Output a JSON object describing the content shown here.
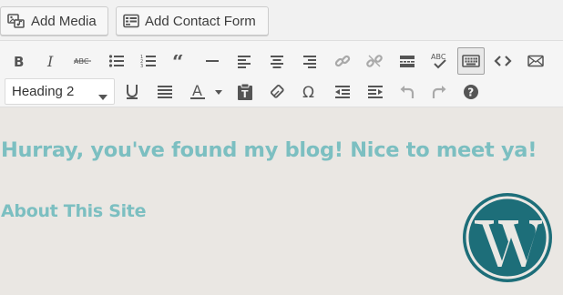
{
  "media_buttons": {
    "add_media": "Add Media",
    "add_contact_form": "Add Contact Form"
  },
  "toolbar": {
    "row1_icons": [
      "bold-icon",
      "italic-icon",
      "strikethrough-icon",
      "bullet-list-icon",
      "numbered-list-icon",
      "blockquote-icon",
      "horizontal-rule-icon",
      "align-left-icon",
      "align-center-icon",
      "align-right-icon",
      "insert-link-icon",
      "remove-link-icon",
      "read-more-icon",
      "spellcheck-icon",
      "toolbar-toggle-icon",
      "code-icon",
      "email-icon"
    ],
    "row2_icons": [
      "underline-icon",
      "justify-icon",
      "text-color-icon",
      "paste-as-text-icon",
      "clear-formatting-icon",
      "special-character-icon",
      "outdent-icon",
      "indent-icon",
      "undo-icon",
      "redo-icon",
      "help-icon"
    ],
    "format_select": {
      "selected": "Heading 2"
    }
  },
  "content": {
    "heading1": "Hurray, you've found my blog! Nice to meet ya!",
    "heading2": "About This Site"
  },
  "colors": {
    "heading": "#7cbfc1",
    "content_background": "#eae7e3",
    "wordpress_logo": "#1d6e79",
    "icon": "#555555"
  }
}
